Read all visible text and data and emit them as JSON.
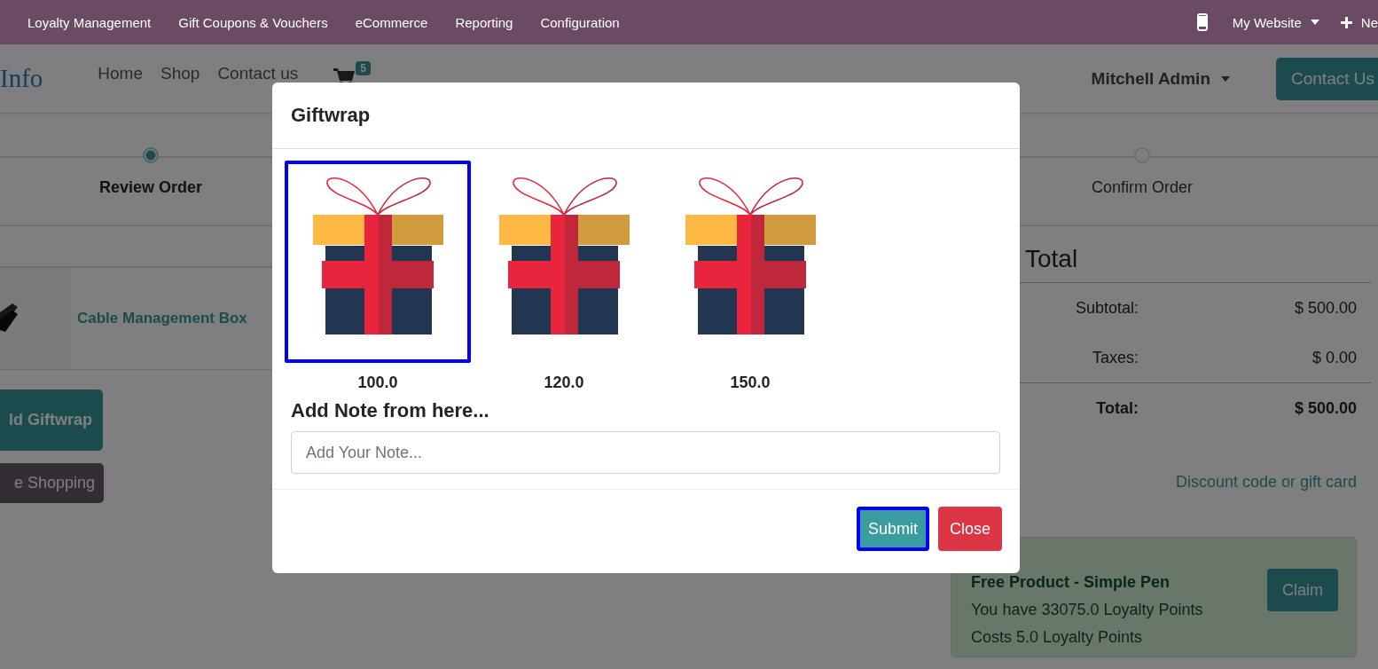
{
  "top_menu": {
    "items": [
      "Loyalty Management",
      "Gift Coupons & Vouchers",
      "eCommerce",
      "Reporting",
      "Configuration"
    ],
    "website": "My Website",
    "new_label": "Ne"
  },
  "header": {
    "logo": "Info",
    "nav": [
      "Home",
      "Shop",
      "Contact us"
    ],
    "cart_count": "5",
    "user": "Mitchell Admin",
    "contact_button": "Contact Us"
  },
  "progress": {
    "steps": [
      {
        "label": "Review Order",
        "selected": true
      },
      {
        "label": "Confirm Order",
        "selected": false
      }
    ]
  },
  "cart": {
    "product": "Cable Management Box",
    "buttons": [
      {
        "label": "ld Giftwrap",
        "kind": "primary"
      },
      {
        "label": "e Shopping",
        "kind": "secondary"
      }
    ]
  },
  "summary": {
    "title": "Total",
    "rows": [
      {
        "label": "Subtotal:",
        "value": "$ 500.00",
        "bold": false
      },
      {
        "label": "Taxes:",
        "value": "$ 0.00",
        "bold": false
      },
      {
        "label": "Total:",
        "value": "$ 500.00",
        "bold": true
      }
    ],
    "discount_link": "Discount code or gift card",
    "reward": {
      "title": "Free Product - Simple Pen",
      "lines": [
        "You have 33075.0 Loyalty Points",
        "Costs 5.0 Loyalty Points"
      ],
      "button": "Claim"
    }
  },
  "modal": {
    "title": "Giftwrap",
    "options": [
      {
        "price": "100.0",
        "selected": true
      },
      {
        "price": "120.0",
        "selected": false
      },
      {
        "price": "150.0",
        "selected": false
      }
    ],
    "note_heading": "Add Note from here...",
    "note": {
      "placeholder": "Add Your Note..."
    },
    "buttons": [
      {
        "label": "Submit",
        "kind": "primary",
        "focused": true
      },
      {
        "label": "Close",
        "kind": "danger",
        "focused": false
      }
    ]
  }
}
